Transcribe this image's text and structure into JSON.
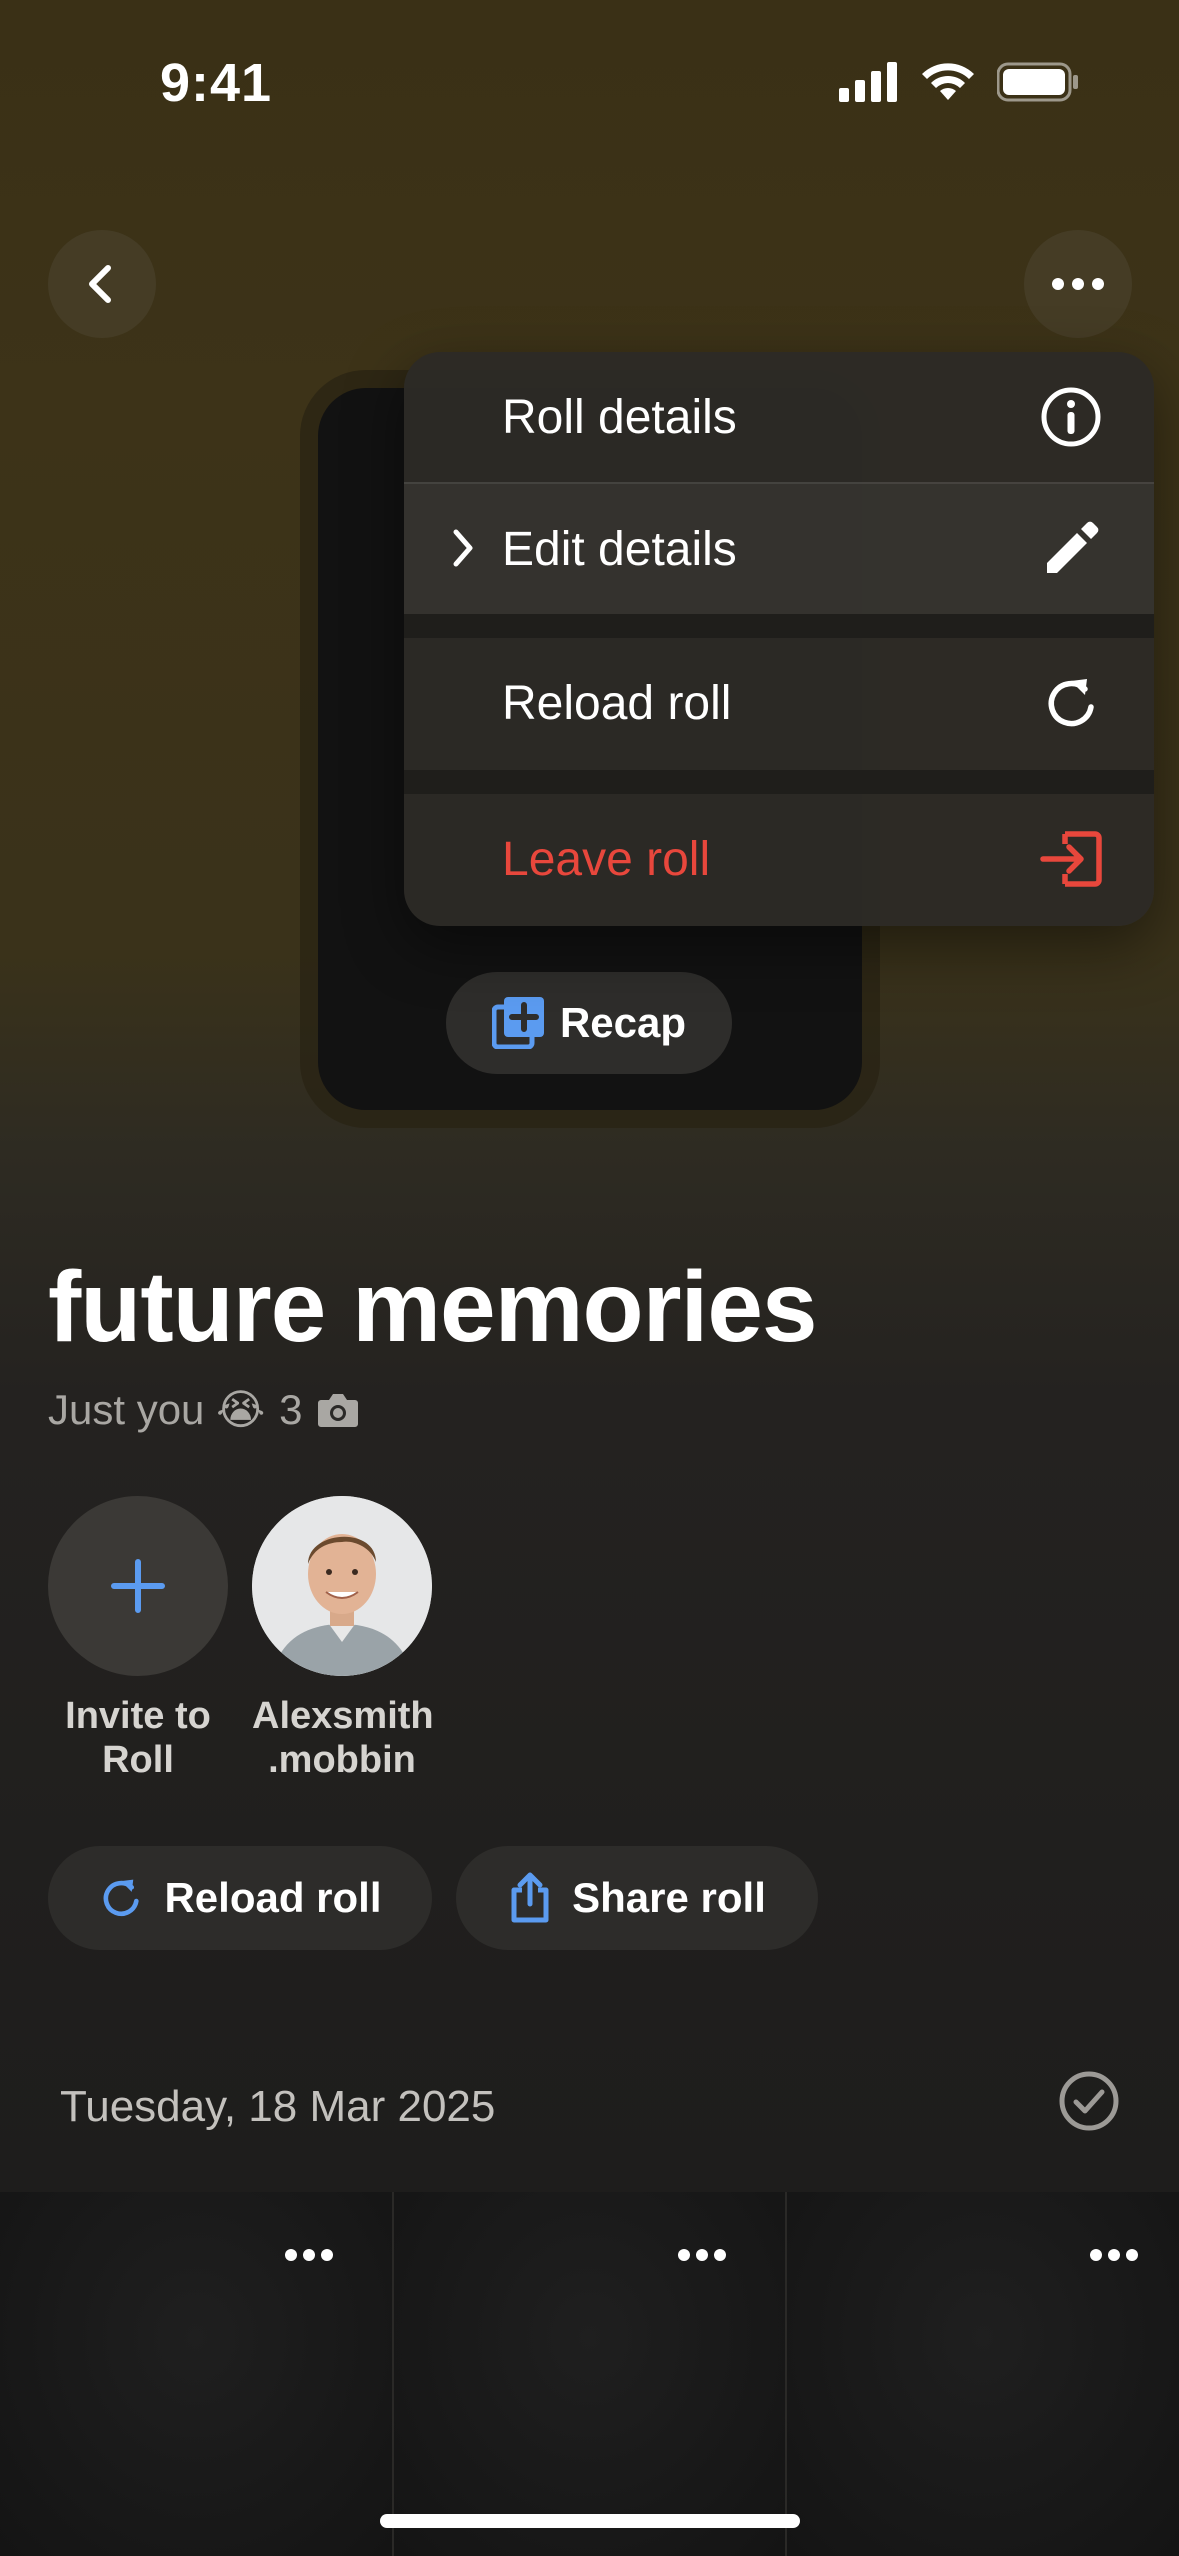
{
  "status_bar": {
    "time": "9:41"
  },
  "header": {
    "back_icon": "chevron-left-icon",
    "more_icon": "ellipsis-icon"
  },
  "menu": {
    "items": [
      {
        "label": "Roll details",
        "icon": "info-icon"
      },
      {
        "label": "Edit details",
        "icon": "pencil-icon",
        "has_submenu": true
      },
      {
        "label": "Reload roll",
        "icon": "reload-icon"
      },
      {
        "label": "Leave roll",
        "icon": "leave-icon",
        "color": "#e8473c"
      }
    ]
  },
  "recap_button": {
    "label": "Recap",
    "icon": "recap-icon"
  },
  "roll": {
    "title": "future memories",
    "subtitle": "Just you 😭",
    "photo_count": "3"
  },
  "participants": [
    {
      "name_line1": "Invite to",
      "name_line2": "Roll",
      "icon": "plus-icon"
    },
    {
      "name_line1": "Alexsmith",
      "name_line2": ".mobbin",
      "icon": "avatar"
    }
  ],
  "actions": {
    "reload_label": "Reload roll",
    "share_label": "Share roll"
  },
  "date_section": {
    "date": "Tuesday, 18 Mar 2025"
  },
  "colors": {
    "accent": "#5b9bf0",
    "danger": "#e8473c"
  }
}
